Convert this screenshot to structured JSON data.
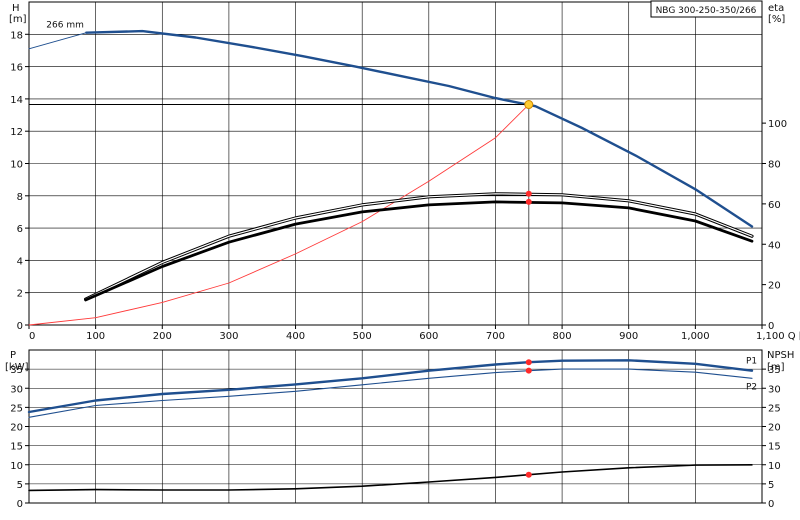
{
  "colors": {
    "head": "#1f4f8f",
    "eta": "#000000",
    "system": "#ff3b3b",
    "op_line": "#000000",
    "grid": "#000000",
    "p1": "#1f4f8f",
    "p2": "#1f4f8f",
    "npsh": "#000000",
    "op_point": "#ff2a2a",
    "op_point_fill": "#ffcc33"
  },
  "chart_data": [
    {
      "type": "line",
      "title": "",
      "subtitle": "",
      "legend_box": "NBG 300-250-350/266",
      "xlabel": "Q [m³/h]",
      "ylabel_left_lines": [
        "H",
        "[m]"
      ],
      "ylabel_right_lines": [
        "eta",
        "[%]"
      ],
      "xlim": [
        0,
        1100
      ],
      "ylim_left": [
        0,
        20
      ],
      "ylim_right": [
        0,
        160
      ],
      "x_ticks": [
        0,
        100,
        200,
        300,
        400,
        500,
        600,
        700,
        800,
        900,
        1000,
        1100
      ],
      "x_tick_labels": [
        "0",
        "100",
        "200",
        "300",
        "400",
        "500",
        "600",
        "700",
        "800",
        "900",
        "1,000",
        "1,100"
      ],
      "y_left_ticks": [
        0,
        2,
        4,
        6,
        8,
        10,
        12,
        14,
        16,
        18
      ],
      "y_left_tick_labels": [
        "0",
        "2",
        "4",
        "6",
        "8",
        "10",
        "12",
        "14",
        "16",
        "18"
      ],
      "y_right_ticks": [
        0,
        20,
        40,
        60,
        80,
        100
      ],
      "y_right_tick_labels": [
        "0",
        "20",
        "40",
        "60",
        "80",
        "100"
      ],
      "grid": true,
      "series": [
        {
          "name": "266 mm",
          "kind": "head_main",
          "axis": "left",
          "x": [
            86,
            170,
            250,
            330,
            410,
            490,
            560,
            630,
            700,
            760,
            830,
            910,
            1000,
            1085
          ],
          "y": [
            18.1,
            18.2,
            17.8,
            17.25,
            16.65,
            16.0,
            15.4,
            14.8,
            14.05,
            13.55,
            12.2,
            10.5,
            8.4,
            6.1
          ]
        },
        {
          "kind": "head_ext",
          "axis": "left",
          "x": [
            0,
            86
          ],
          "y": [
            17.1,
            18.1
          ]
        },
        {
          "kind": "system",
          "axis": "left",
          "x": [
            0,
            100,
            200,
            300,
            400,
            500,
            600,
            700,
            750
          ],
          "y": [
            0,
            0.45,
            1.4,
            2.6,
            4.4,
            6.4,
            8.9,
            11.6,
            13.65
          ]
        },
        {
          "kind": "eta_outer",
          "axis": "right",
          "x": [
            85,
            200,
            300,
            400,
            500,
            600,
            700,
            800,
            900,
            1000,
            1085
          ],
          "y": [
            12.8,
            31.0,
            44.0,
            53.0,
            59.5,
            63.5,
            65.0,
            64.5,
            61.5,
            55.0,
            44.0
          ]
        },
        {
          "kind": "eta_inner",
          "axis": "right",
          "x": [
            85,
            200,
            300,
            400,
            500,
            600,
            700,
            800,
            900,
            1000,
            1085
          ],
          "y": [
            12.4,
            29.0,
            41.0,
            50.0,
            56.0,
            59.5,
            61.0,
            60.5,
            58.0,
            51.5,
            41.5
          ]
        }
      ],
      "operating_point": {
        "q": 750,
        "h": 13.65,
        "eta_outer": 65.0,
        "eta_inner": 61.0
      }
    },
    {
      "type": "line",
      "ylabel_left_lines": [
        "P",
        "[kW]"
      ],
      "ylabel_right_lines": [
        "NPSH",
        "[m]"
      ],
      "xlim": [
        0,
        1100
      ],
      "ylim": [
        0,
        40
      ],
      "y_ticks": [
        0,
        5,
        10,
        15,
        20,
        25,
        30,
        35
      ],
      "y_tick_labels": [
        "0",
        "5",
        "10",
        "15",
        "20",
        "25",
        "30",
        "35"
      ],
      "y_right_ticks": [
        0,
        5,
        10,
        15,
        20,
        25,
        30,
        35
      ],
      "y_right_tick_labels": [
        "0",
        "5",
        "10",
        "15",
        "20",
        "25",
        "30",
        "35"
      ],
      "grid": true,
      "series": [
        {
          "name": "P1",
          "kind": "p1",
          "x": [
            0,
            100,
            200,
            300,
            400,
            500,
            600,
            700,
            750,
            800,
            900,
            1000,
            1085
          ],
          "y": [
            23.8,
            26.8,
            28.5,
            29.6,
            31.0,
            32.6,
            34.6,
            36.2,
            36.8,
            37.2,
            37.3,
            36.4,
            34.6
          ]
        },
        {
          "name": "P2",
          "kind": "p2",
          "x": [
            0,
            100,
            200,
            300,
            400,
            500,
            600,
            700,
            750,
            800,
            900,
            1000,
            1085
          ],
          "y": [
            22.4,
            25.5,
            26.8,
            27.9,
            29.2,
            30.9,
            32.6,
            34.1,
            34.6,
            35.0,
            35.0,
            34.2,
            32.6
          ]
        },
        {
          "kind": "npsh",
          "x": [
            0,
            100,
            200,
            300,
            400,
            500,
            600,
            700,
            750,
            800,
            900,
            1000,
            1085
          ],
          "y": [
            3.3,
            3.5,
            3.4,
            3.4,
            3.7,
            4.4,
            5.5,
            6.7,
            7.4,
            8.1,
            9.2,
            9.9,
            10.0
          ]
        }
      ],
      "operating_point": {
        "q": 750,
        "p1": 36.8,
        "p2": 34.6,
        "npsh": 7.4
      }
    }
  ]
}
